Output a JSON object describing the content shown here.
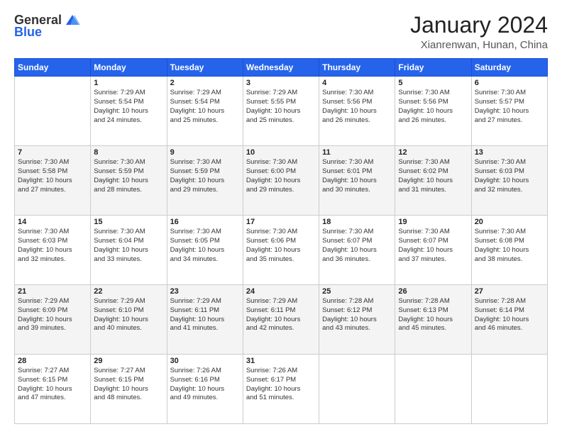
{
  "header": {
    "logo_general": "General",
    "logo_blue": "Blue",
    "title": "January 2024",
    "location": "Xianrenwan, Hunan, China"
  },
  "days_of_week": [
    "Sunday",
    "Monday",
    "Tuesday",
    "Wednesday",
    "Thursday",
    "Friday",
    "Saturday"
  ],
  "weeks": [
    [
      {
        "day": "",
        "info": ""
      },
      {
        "day": "1",
        "info": "Sunrise: 7:29 AM\nSunset: 5:54 PM\nDaylight: 10 hours\nand 24 minutes."
      },
      {
        "day": "2",
        "info": "Sunrise: 7:29 AM\nSunset: 5:54 PM\nDaylight: 10 hours\nand 25 minutes."
      },
      {
        "day": "3",
        "info": "Sunrise: 7:29 AM\nSunset: 5:55 PM\nDaylight: 10 hours\nand 25 minutes."
      },
      {
        "day": "4",
        "info": "Sunrise: 7:30 AM\nSunset: 5:56 PM\nDaylight: 10 hours\nand 26 minutes."
      },
      {
        "day": "5",
        "info": "Sunrise: 7:30 AM\nSunset: 5:56 PM\nDaylight: 10 hours\nand 26 minutes."
      },
      {
        "day": "6",
        "info": "Sunrise: 7:30 AM\nSunset: 5:57 PM\nDaylight: 10 hours\nand 27 minutes."
      }
    ],
    [
      {
        "day": "7",
        "info": "Sunrise: 7:30 AM\nSunset: 5:58 PM\nDaylight: 10 hours\nand 27 minutes."
      },
      {
        "day": "8",
        "info": "Sunrise: 7:30 AM\nSunset: 5:59 PM\nDaylight: 10 hours\nand 28 minutes."
      },
      {
        "day": "9",
        "info": "Sunrise: 7:30 AM\nSunset: 5:59 PM\nDaylight: 10 hours\nand 29 minutes."
      },
      {
        "day": "10",
        "info": "Sunrise: 7:30 AM\nSunset: 6:00 PM\nDaylight: 10 hours\nand 29 minutes."
      },
      {
        "day": "11",
        "info": "Sunrise: 7:30 AM\nSunset: 6:01 PM\nDaylight: 10 hours\nand 30 minutes."
      },
      {
        "day": "12",
        "info": "Sunrise: 7:30 AM\nSunset: 6:02 PM\nDaylight: 10 hours\nand 31 minutes."
      },
      {
        "day": "13",
        "info": "Sunrise: 7:30 AM\nSunset: 6:03 PM\nDaylight: 10 hours\nand 32 minutes."
      }
    ],
    [
      {
        "day": "14",
        "info": "Sunrise: 7:30 AM\nSunset: 6:03 PM\nDaylight: 10 hours\nand 32 minutes."
      },
      {
        "day": "15",
        "info": "Sunrise: 7:30 AM\nSunset: 6:04 PM\nDaylight: 10 hours\nand 33 minutes."
      },
      {
        "day": "16",
        "info": "Sunrise: 7:30 AM\nSunset: 6:05 PM\nDaylight: 10 hours\nand 34 minutes."
      },
      {
        "day": "17",
        "info": "Sunrise: 7:30 AM\nSunset: 6:06 PM\nDaylight: 10 hours\nand 35 minutes."
      },
      {
        "day": "18",
        "info": "Sunrise: 7:30 AM\nSunset: 6:07 PM\nDaylight: 10 hours\nand 36 minutes."
      },
      {
        "day": "19",
        "info": "Sunrise: 7:30 AM\nSunset: 6:07 PM\nDaylight: 10 hours\nand 37 minutes."
      },
      {
        "day": "20",
        "info": "Sunrise: 7:30 AM\nSunset: 6:08 PM\nDaylight: 10 hours\nand 38 minutes."
      }
    ],
    [
      {
        "day": "21",
        "info": "Sunrise: 7:29 AM\nSunset: 6:09 PM\nDaylight: 10 hours\nand 39 minutes."
      },
      {
        "day": "22",
        "info": "Sunrise: 7:29 AM\nSunset: 6:10 PM\nDaylight: 10 hours\nand 40 minutes."
      },
      {
        "day": "23",
        "info": "Sunrise: 7:29 AM\nSunset: 6:11 PM\nDaylight: 10 hours\nand 41 minutes."
      },
      {
        "day": "24",
        "info": "Sunrise: 7:29 AM\nSunset: 6:11 PM\nDaylight: 10 hours\nand 42 minutes."
      },
      {
        "day": "25",
        "info": "Sunrise: 7:28 AM\nSunset: 6:12 PM\nDaylight: 10 hours\nand 43 minutes."
      },
      {
        "day": "26",
        "info": "Sunrise: 7:28 AM\nSunset: 6:13 PM\nDaylight: 10 hours\nand 45 minutes."
      },
      {
        "day": "27",
        "info": "Sunrise: 7:28 AM\nSunset: 6:14 PM\nDaylight: 10 hours\nand 46 minutes."
      }
    ],
    [
      {
        "day": "28",
        "info": "Sunrise: 7:27 AM\nSunset: 6:15 PM\nDaylight: 10 hours\nand 47 minutes."
      },
      {
        "day": "29",
        "info": "Sunrise: 7:27 AM\nSunset: 6:15 PM\nDaylight: 10 hours\nand 48 minutes."
      },
      {
        "day": "30",
        "info": "Sunrise: 7:26 AM\nSunset: 6:16 PM\nDaylight: 10 hours\nand 49 minutes."
      },
      {
        "day": "31",
        "info": "Sunrise: 7:26 AM\nSunset: 6:17 PM\nDaylight: 10 hours\nand 51 minutes."
      },
      {
        "day": "",
        "info": ""
      },
      {
        "day": "",
        "info": ""
      },
      {
        "day": "",
        "info": ""
      }
    ]
  ]
}
